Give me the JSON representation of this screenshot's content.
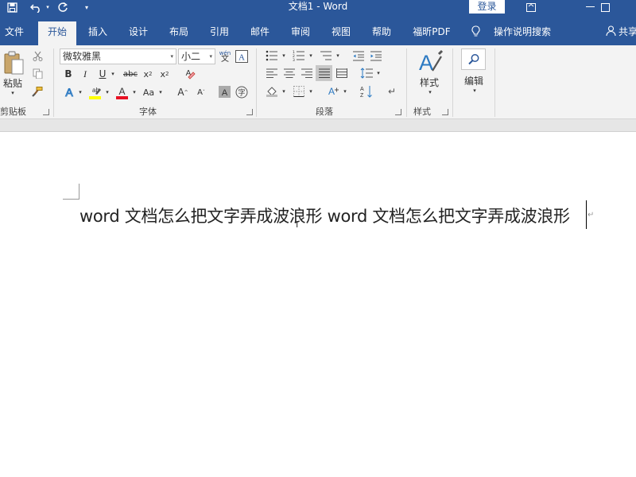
{
  "titlebar": {
    "document_title": "文档1  -  Word",
    "login_label": "登录"
  },
  "tabs": [
    {
      "label": "文件"
    },
    {
      "label": "开始"
    },
    {
      "label": "插入"
    },
    {
      "label": "设计"
    },
    {
      "label": "布局"
    },
    {
      "label": "引用"
    },
    {
      "label": "邮件"
    },
    {
      "label": "审阅"
    },
    {
      "label": "视图"
    },
    {
      "label": "帮助"
    },
    {
      "label": "福昕PDF"
    }
  ],
  "search": {
    "label": "操作说明搜索"
  },
  "share": {
    "label": "共享"
  },
  "ribbon": {
    "clipboard": {
      "paste_label": "粘贴",
      "group_label": "剪贴板"
    },
    "font": {
      "font_name": "微软雅黑",
      "font_size": "小二",
      "group_label": "字体",
      "phonetic_glyph": "wén"
    },
    "paragraph": {
      "group_label": "段落"
    },
    "styles": {
      "button_label": "样式",
      "group_label": "样式"
    },
    "editing": {
      "button_label": "编辑"
    }
  },
  "document": {
    "text": "word 文档怎么把文字弄成波浪形 word 文档怎么把文字弄成波浪形"
  },
  "colors": {
    "brand": "#2b579a",
    "ribbon_bg": "#f3f3f3",
    "highlight_yellow": "#ffff00",
    "font_red": "#e81123"
  }
}
